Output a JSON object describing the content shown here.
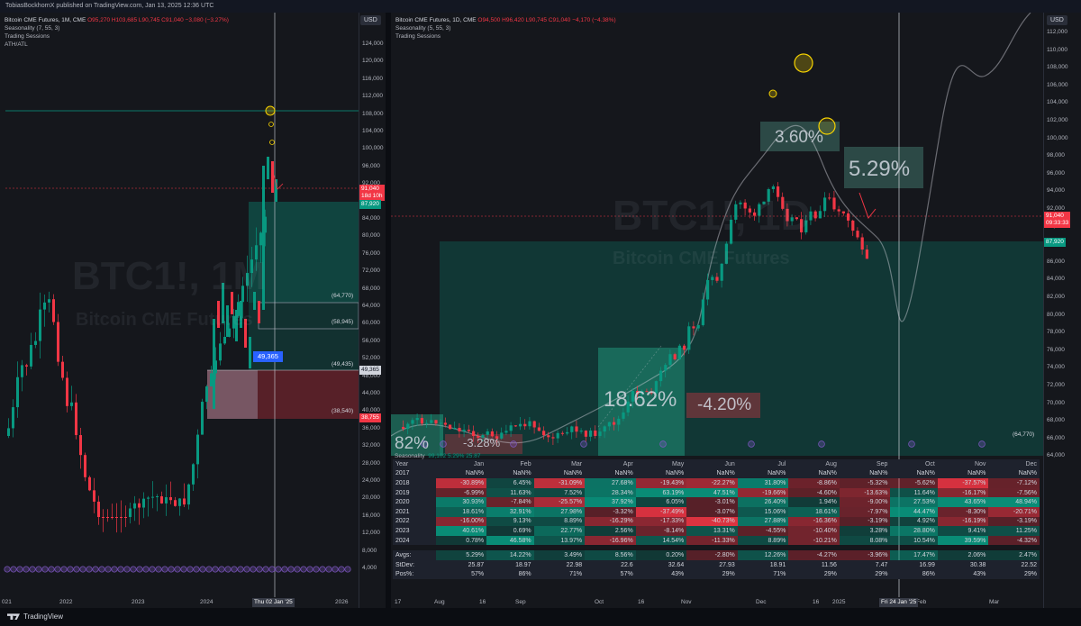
{
  "publisher_line": "TobiasBockhornX published on TradingView.com, Jan 13, 2025 12:36 UTC",
  "colors": {
    "up": "#089981",
    "down": "#f23645",
    "bg": "#15171c",
    "accent_blue": "#2962ff",
    "purple": "#7e57c2",
    "yellow": "#f7d300"
  },
  "left_chart": {
    "legend": {
      "symbol": "Bitcoin CME Futures, 1M, CME",
      "ohlc": "O95,270 H103,685 L90,745 C91,040 −3,080 (−3.27%)",
      "indicator_1": "Seasonality (7, 55, 3)",
      "indicator_2": "Trading Sessions",
      "indicator_3": "ATH/ATL"
    },
    "currency": "USD",
    "watermark_symbol": "BTC1!, 1M",
    "watermark_name": "Bitcoin CME Futures",
    "price_ticks": [
      "124,000",
      "120,000",
      "116,000",
      "112,000",
      "108,000",
      "104,000",
      "100,000",
      "96,000",
      "92,000",
      "88,000",
      "84,000",
      "80,000",
      "76,000",
      "72,000",
      "68,000",
      "64,000",
      "60,000",
      "56,000",
      "52,000",
      "48,000",
      "44,000",
      "40,000",
      "36,000",
      "32,000",
      "28,000",
      "24,000",
      "20,000",
      "16,000",
      "12,000",
      "8,000",
      "4,000"
    ],
    "time_ticks": [
      "021",
      "2022",
      "2023",
      "2024",
      "2026"
    ],
    "cursor_time": "Thu 02 Jan '25",
    "last_price": "91,040",
    "countdown": "18d 10h",
    "tag_green": "87,920",
    "tag_red": "38,755",
    "tag_white": "49,365",
    "callout": "49,365",
    "zone_labels": [
      "(64,770)",
      "(58,945)",
      "(49,435)",
      "(38,540)"
    ],
    "session_icon": "◷"
  },
  "right_chart": {
    "legend": {
      "symbol": "Bitcoin CME Futures, 1D, CME",
      "ohlc": "O94,500 H96,420 L90,745 C91,040 −4,170 (−4.38%)",
      "indicator_1": "Seasonality (5, 55, 3)",
      "indicator_2": "Trading Sessions"
    },
    "currency": "USD",
    "watermark_symbol": "BTC1!, 1D",
    "watermark_name": "Bitcoin CME Futures",
    "price_ticks": [
      "112,000",
      "110,000",
      "108,000",
      "106,000",
      "104,000",
      "102,000",
      "100,000",
      "98,000",
      "96,000",
      "94,000",
      "92,000",
      "90,000",
      "88,000",
      "86,000",
      "84,000",
      "82,000",
      "80,000",
      "78,000",
      "76,000",
      "74,000",
      "72,000",
      "70,000",
      "68,000",
      "66,000",
      "64,000"
    ],
    "time_ticks": [
      "17",
      "Aug",
      "16",
      "Sep",
      "Oct",
      "16",
      "Nov",
      "Dec",
      "16",
      "2025",
      "Feb",
      "Mar"
    ],
    "cursor_time": "Fri 24 Jan '25",
    "last_price": "91,040",
    "countdown": "09:33:33",
    "tag_green": "87,920",
    "zone_label": "(64,770)",
    "box_labels": [
      "3.60%",
      "5.29%",
      "18.62%",
      "-4.20%",
      "-3.28%",
      "82%"
    ],
    "session_icon": "◷"
  },
  "seasonality": {
    "label": "Seasonality",
    "values_inline": [
      "99,102",
      "5.29%",
      "25.87"
    ],
    "header": [
      "Year",
      "Jan",
      "Feb",
      "Mar",
      "Apr",
      "May",
      "Jun",
      "Jul",
      "Aug",
      "Sep",
      "Oct",
      "Nov",
      "Dec"
    ],
    "rows": [
      [
        "2017",
        "NaN%",
        "NaN%",
        "NaN%",
        "NaN%",
        "NaN%",
        "NaN%",
        "NaN%",
        "NaN%",
        "NaN%",
        "NaN%",
        "NaN%",
        "NaN%"
      ],
      [
        "2018",
        "-30.89%",
        "6.45%",
        "-31.09%",
        "27.68%",
        "-19.43%",
        "-22.27%",
        "31.80%",
        "-8.86%",
        "-5.32%",
        "-5.62%",
        "-37.57%",
        "-7.12%"
      ],
      [
        "2019",
        "-6.99%",
        "11.63%",
        "7.52%",
        "28.34%",
        "63.19%",
        "47.51%",
        "-19.66%",
        "-4.60%",
        "-13.63%",
        "11.64%",
        "-16.17%",
        "-7.56%"
      ],
      [
        "2020",
        "30.93%",
        "-7.84%",
        "-25.57%",
        "37.92%",
        "6.05%",
        "-3.01%",
        "26.40%",
        "1.94%",
        "-9.00%",
        "27.53%",
        "43.65%",
        "48.94%"
      ],
      [
        "2021",
        "18.61%",
        "32.91%",
        "27.98%",
        "-3.32%",
        "-37.49%",
        "-3.07%",
        "15.06%",
        "18.61%",
        "-7.97%",
        "44.47%",
        "-8.30%",
        "-20.71%"
      ],
      [
        "2022",
        "-16.00%",
        "9.13%",
        "8.89%",
        "-16.29%",
        "-17.33%",
        "-40.73%",
        "27.88%",
        "-16.36%",
        "-3.19%",
        "4.92%",
        "-16.19%",
        "-3.19%"
      ],
      [
        "2023",
        "40.61%",
        "0.69%",
        "22.77%",
        "2.56%",
        "-8.14%",
        "13.31%",
        "-4.55%",
        "-10.40%",
        "3.28%",
        "28.80%",
        "9.41%",
        "11.25%"
      ],
      [
        "2024",
        "0.78%",
        "46.58%",
        "13.97%",
        "-16.96%",
        "14.54%",
        "-11.33%",
        "8.89%",
        "-10.21%",
        "8.08%",
        "10.54%",
        "39.59%",
        "-4.32%"
      ]
    ],
    "summary": [
      [
        "Avgs:",
        "5.29%",
        "14.22%",
        "3.49%",
        "8.56%",
        "0.20%",
        "-2.80%",
        "12.26%",
        "-4.27%",
        "-3.96%",
        "17.47%",
        "2.06%",
        "2.47%"
      ],
      [
        "StDev:",
        "25.87",
        "18.97",
        "22.98",
        "22.6",
        "32.64",
        "27.93",
        "18.91",
        "11.56",
        "7.47",
        "16.99",
        "30.38",
        "22.52"
      ],
      [
        "Pos%:",
        "57%",
        "86%",
        "71%",
        "57%",
        "43%",
        "29%",
        "71%",
        "29%",
        "29%",
        "86%",
        "43%",
        "29%"
      ]
    ]
  },
  "footer": {
    "brand": "TradingView"
  }
}
